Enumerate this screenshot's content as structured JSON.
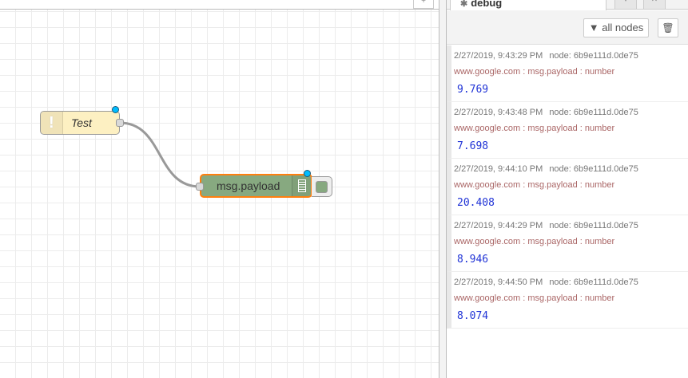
{
  "sidebar": {
    "tab_label": "debug",
    "filter_label": "all nodes",
    "messages": [
      {
        "time": "2/27/2019, 9:43:29 PM",
        "node": "node: 6b9e111d.0de75",
        "topic": "www.google.com : msg.payload : number",
        "value": "9.769"
      },
      {
        "time": "2/27/2019, 9:43:48 PM",
        "node": "node: 6b9e111d.0de75",
        "topic": "www.google.com : msg.payload : number",
        "value": "7.698"
      },
      {
        "time": "2/27/2019, 9:44:10 PM",
        "node": "node: 6b9e111d.0de75",
        "topic": "www.google.com : msg.payload : number",
        "value": "20.408"
      },
      {
        "time": "2/27/2019, 9:44:29 PM",
        "node": "node: 6b9e111d.0de75",
        "topic": "www.google.com : msg.payload : number",
        "value": "8.946"
      },
      {
        "time": "2/27/2019, 9:44:50 PM",
        "node": "node: 6b9e111d.0de75",
        "topic": "www.google.com : msg.payload : number",
        "value": "8.074"
      }
    ]
  },
  "nodes": {
    "inject_label": "Test",
    "debug_label": "msg.payload"
  },
  "colors": {
    "inject_fill": "#fdf0c2",
    "debug_fill": "#87a980",
    "selected_border": "#ff7f0e",
    "changed_dot": "#00bcff",
    "value_text": "#2033d6"
  },
  "icons": {
    "inject": "exclamation-icon",
    "debug": "list-icon",
    "filter": "funnel-icon",
    "clear": "trash-icon"
  }
}
